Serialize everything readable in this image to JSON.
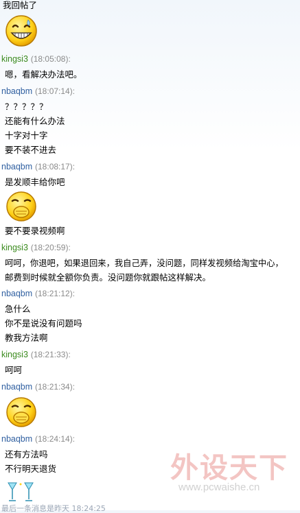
{
  "colors": {
    "sender_green": "#3a8a1d",
    "sender_blue": "#2f5fa0",
    "timestamp": "#8a8a8a"
  },
  "chat": {
    "top_message": "我回帖了",
    "entries": [
      {
        "sender": "kingsi3",
        "time": "(18:05:08):",
        "lines": [
          "嗯，看解决办法吧。"
        ]
      },
      {
        "sender": "nbaqbm",
        "time": "(18:07:14):",
        "lines": [
          "？？？？？",
          "还能有什么办法",
          "十字对十字",
          "要不装不进去"
        ]
      },
      {
        "sender": "nbaqbm",
        "time": "(18:08:17):",
        "lines": [
          "是发顺丰给你吧",
          "要不要录视频啊"
        ]
      },
      {
        "sender": "kingsi3",
        "time": "(18:20:59):",
        "lines": [
          "呵呵，你退吧，如果退回来，我自己弄，没问题，同样发视频给淘宝中心，",
          "邮费到时候就全额你负责。没问题你就跟帖这样解决。"
        ]
      },
      {
        "sender": "nbaqbm",
        "time": "(18:21:12):",
        "lines": [
          "急什么",
          "你不是说没有问题吗",
          "教我方法啊"
        ]
      },
      {
        "sender": "kingsi3",
        "time": "(18:21:33):",
        "lines": [
          "呵呵"
        ]
      },
      {
        "sender": "nbaqbm",
        "time": "(18:21:34):",
        "lines": []
      },
      {
        "sender": "nbaqbm",
        "time": "(18:24:14):",
        "lines": [
          "还有方法吗",
          "不行明天退货"
        ]
      }
    ],
    "emoticons": [
      "grin-emoticon",
      "cover-mouth-emoticon",
      "cover-mouth-emoticon",
      "cheers-glasses-emoticon"
    ],
    "bottom_partial": "最后一条消息是昨天 18:24:25"
  },
  "watermark": {
    "brand": "外设天下",
    "url": "www.pcwaishe.cn"
  }
}
